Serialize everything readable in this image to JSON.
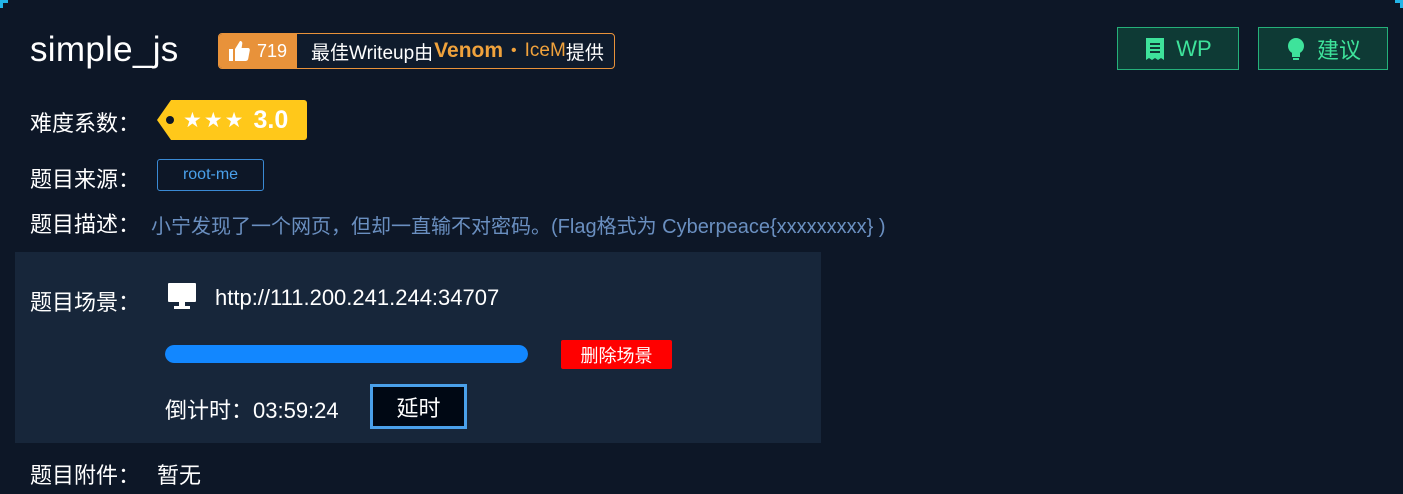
{
  "challenge": {
    "title": "simple_js",
    "likes": "719",
    "credit": {
      "prefix": "最佳Writeup由",
      "author1": "Venom",
      "separator": "•",
      "author2": "IceM",
      "suffix": "提供"
    }
  },
  "top_buttons": {
    "wp_label": "WP",
    "suggest_label": "建议"
  },
  "difficulty": {
    "label": "难度系数：",
    "stars": 3,
    "score": "3.0"
  },
  "source": {
    "label": "题目来源：",
    "tag": "root-me"
  },
  "description": {
    "label": "题目描述：",
    "text": "小宁发现了一个网页，但却一直输不对密码。(Flag格式为 Cyberpeace{xxxxxxxxx} )"
  },
  "scene": {
    "label": "题目场景：",
    "url": "http://111.200.241.244:34707",
    "progress": 1.0,
    "delete_label": "删除场景",
    "countdown": "倒计时：03:59:24",
    "extend_label": "延时"
  },
  "attachment": {
    "label": "题目附件：",
    "value": "暂无"
  },
  "colors": {
    "background": "#0d1727",
    "panel": "#17263a",
    "accent_orange": "#e8923a",
    "accent_green": "#3ee39b",
    "progress_blue": "#1287ff",
    "danger": "#ff0000"
  }
}
